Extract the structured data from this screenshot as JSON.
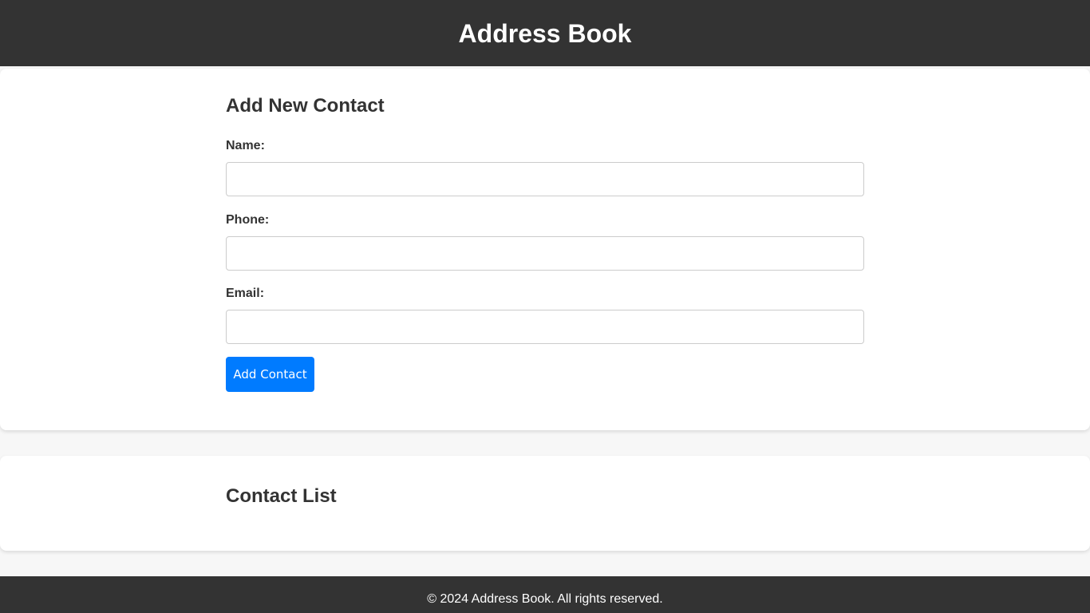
{
  "header": {
    "title": "Address Book"
  },
  "add_contact": {
    "heading": "Add New Contact",
    "fields": [
      {
        "label": "Name:",
        "value": "",
        "placeholder": ""
      },
      {
        "label": "Phone:",
        "value": "",
        "placeholder": ""
      },
      {
        "label": "Email:",
        "value": "",
        "placeholder": ""
      }
    ],
    "submit_label": "Add Contact"
  },
  "contact_list": {
    "heading": "Contact List",
    "items": []
  },
  "footer": {
    "text": "© 2024 Address Book. All rights reserved."
  },
  "colors": {
    "header_bg": "#333333",
    "page_bg": "#f7f7f7",
    "card_bg": "#ffffff",
    "accent": "#007bff",
    "text": "#333333"
  }
}
